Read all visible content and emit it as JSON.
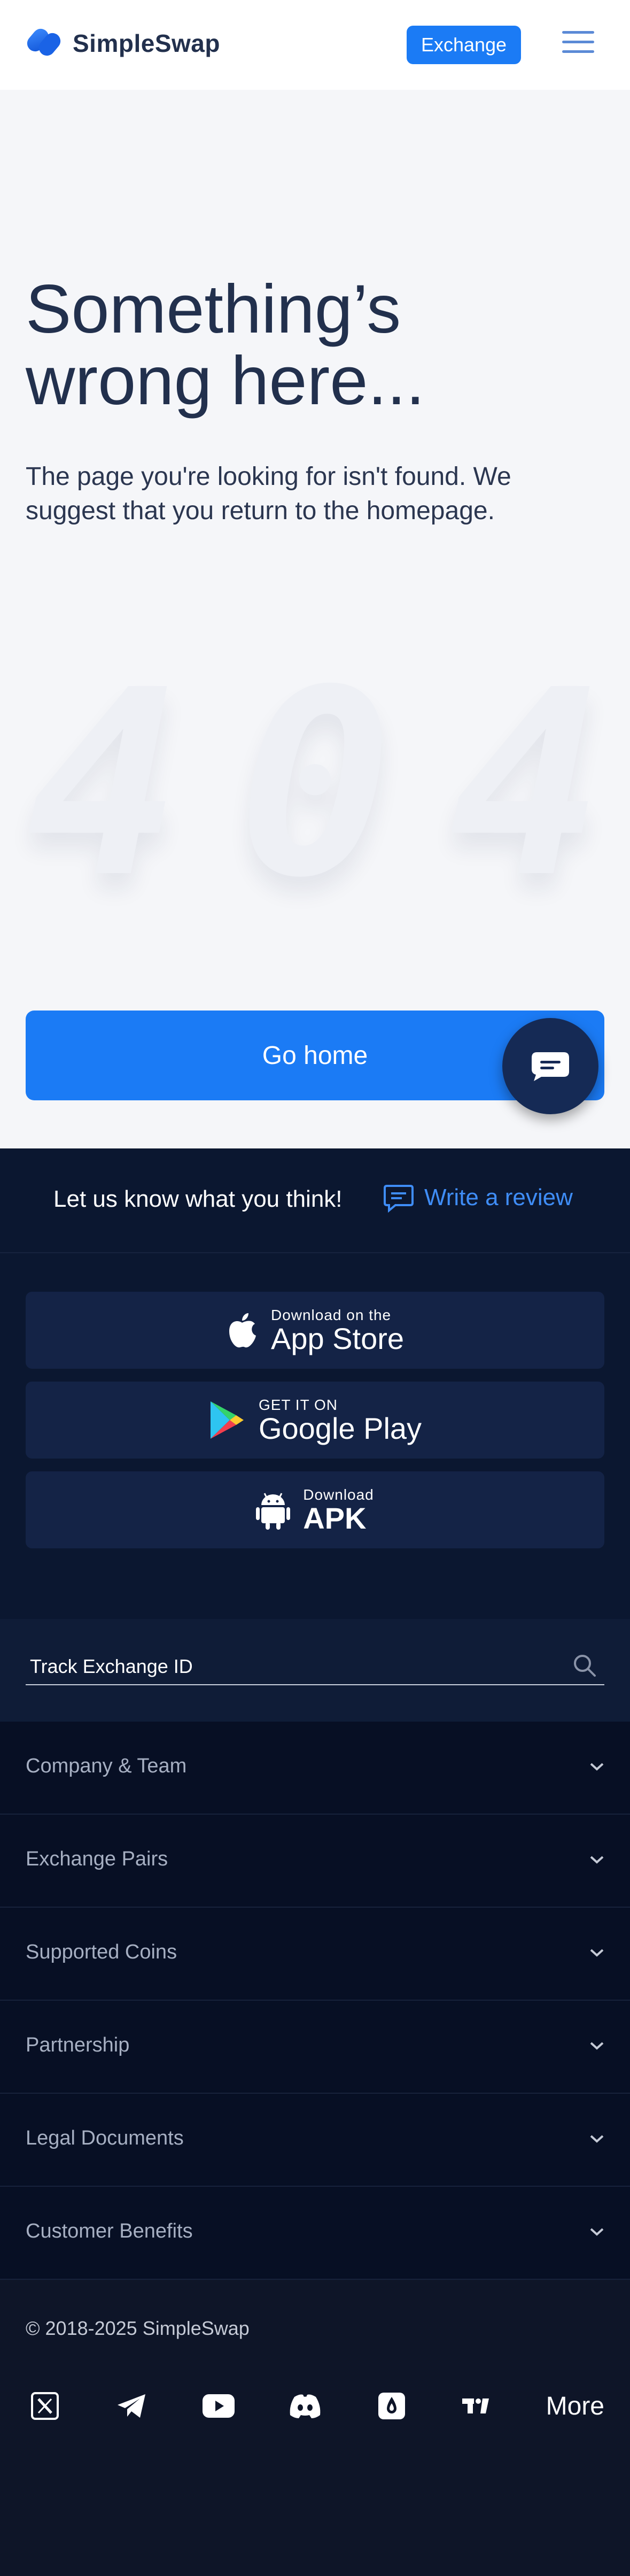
{
  "header": {
    "brand": "SimpleSwap",
    "exchange_button": "Exchange"
  },
  "main": {
    "headline_line1": "Something’s",
    "headline_line2": "wrong here...",
    "subtitle": "The page you're looking for isn't found. We suggest that you return to the homepage.",
    "error_digits": [
      "4",
      "0",
      "4"
    ],
    "go_home_button": "Go home"
  },
  "footer": {
    "review_prompt": "Let us know what you think!",
    "review_link": "Write a review",
    "app_store": {
      "small": "Download on the",
      "big": "App Store"
    },
    "google_play": {
      "small": "GET IT ON",
      "big": "Google Play"
    },
    "apk": {
      "small": "Download",
      "big": "APK"
    },
    "track_label": "Track Exchange ID",
    "accordion": [
      "Company & Team",
      "Exchange Pairs",
      "Supported Coins",
      "Partnership",
      "Legal Documents",
      "Customer Benefits"
    ],
    "copyright": "© 2018-2025 SimpleSwap",
    "socials": [
      "x-icon",
      "telegram-icon",
      "youtube-icon",
      "discord-icon",
      "medium-icon",
      "tradingview-icon"
    ],
    "more": "More"
  },
  "colors": {
    "accent": "#1b7bf5",
    "brand_text": "#22304d",
    "footer_bg": "#0b1730"
  }
}
